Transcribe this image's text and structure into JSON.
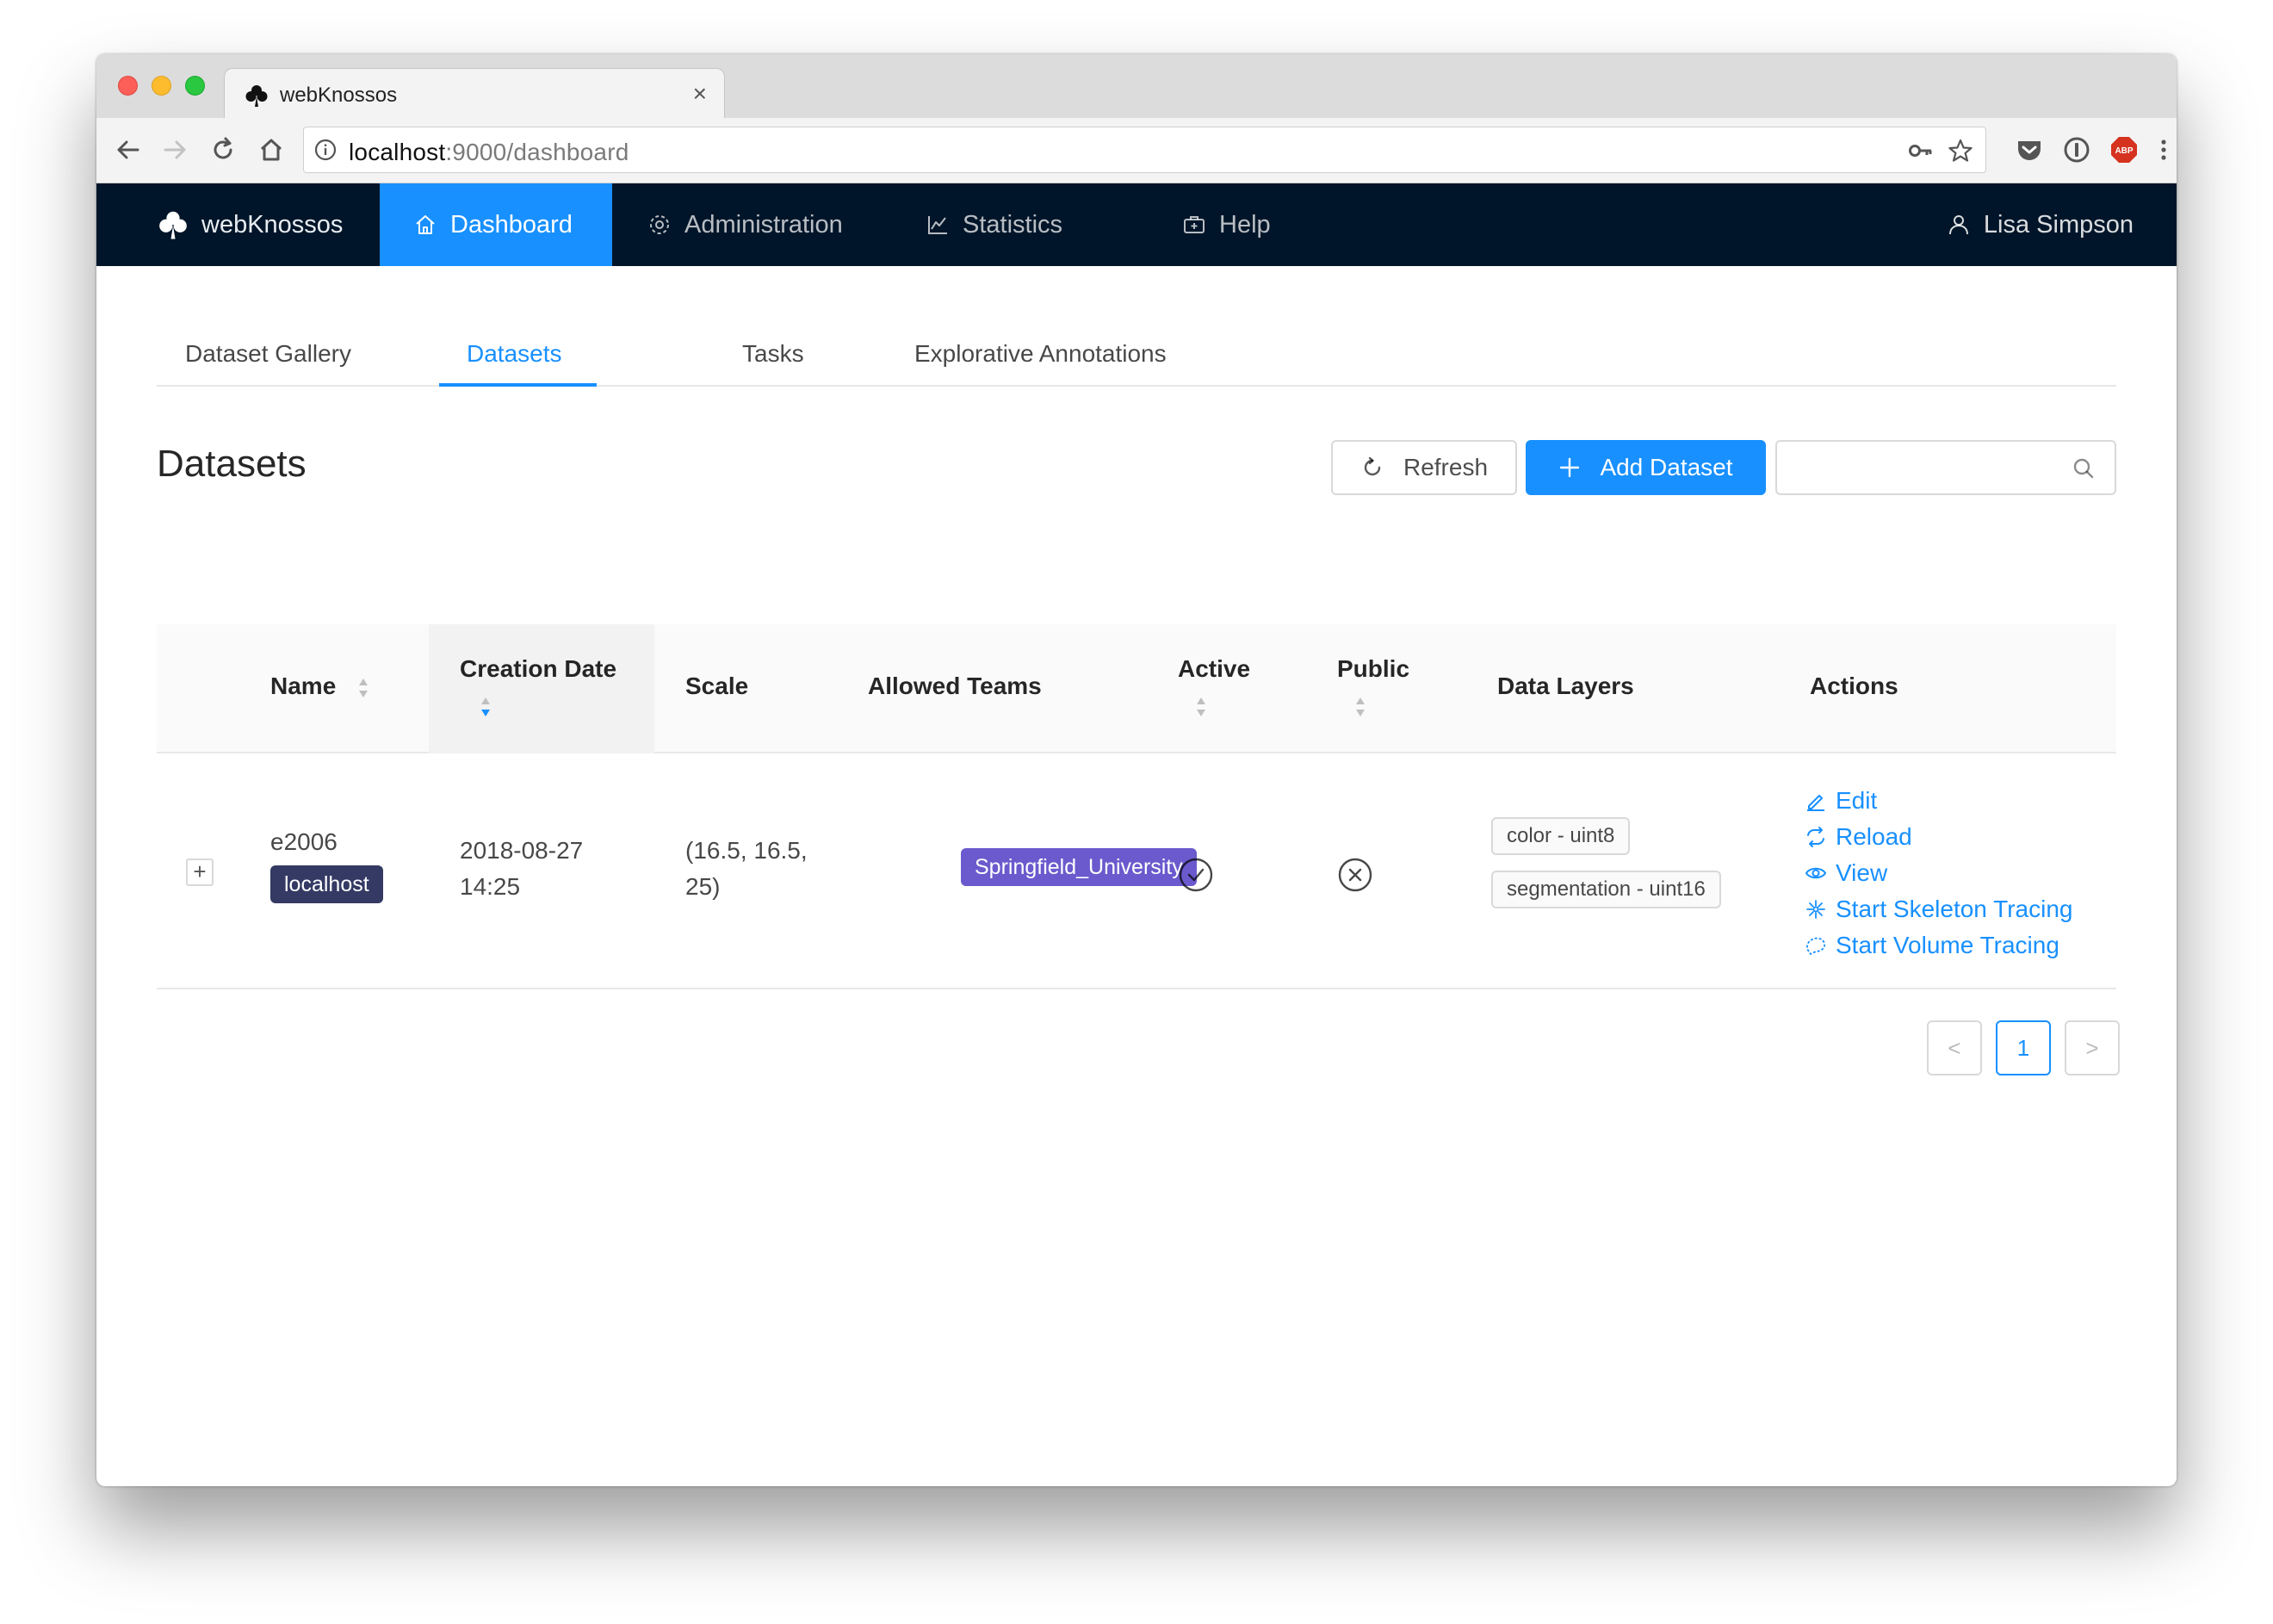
{
  "browser": {
    "tab_title": "webKnossos",
    "tab_close": "×",
    "url_host": "localhost",
    "url_rest": ":9000/dashboard"
  },
  "navbar": {
    "brand": "webKnossos",
    "items": [
      {
        "label": "Dashboard",
        "icon": "home-icon",
        "active": true
      },
      {
        "label": "Administration",
        "icon": "gear-icon",
        "active": false
      },
      {
        "label": "Statistics",
        "icon": "line-chart-icon",
        "active": false
      },
      {
        "label": "Help",
        "icon": "medicine-box-icon",
        "active": false
      }
    ],
    "user": "Lisa Simpson"
  },
  "tabs": [
    {
      "label": "Dataset Gallery",
      "active": false
    },
    {
      "label": "Datasets",
      "active": true
    },
    {
      "label": "Tasks",
      "active": false
    },
    {
      "label": "Explorative Annotations",
      "active": false
    }
  ],
  "page": {
    "title": "Datasets",
    "refresh_label": "Refresh",
    "add_label": "Add Dataset",
    "search_placeholder": ""
  },
  "table": {
    "columns": [
      "Name",
      "Creation Date",
      "Scale",
      "Allowed Teams",
      "Active",
      "Public",
      "Data Layers",
      "Actions"
    ],
    "rows": [
      {
        "expand": "+",
        "name": "e2006",
        "datastore": "localhost",
        "date": "2018-08-27",
        "time": "14:25",
        "scale_line1": "(16.5, 16.5,",
        "scale_line2": "25)",
        "team": "Springfield_University",
        "active": true,
        "public": false,
        "layers": [
          "color - uint8",
          "segmentation - uint16"
        ],
        "actions": [
          "Edit",
          "Reload",
          "View",
          "Start Skeleton Tracing",
          "Start Volume Tracing"
        ]
      }
    ]
  },
  "pagination": {
    "prev": "<",
    "current": "1",
    "next": ">"
  },
  "colors": {
    "primary": "#1890ff",
    "navbar": "#001529",
    "team_tag": "#6a5acd",
    "datastore_tag": "#343a64"
  }
}
